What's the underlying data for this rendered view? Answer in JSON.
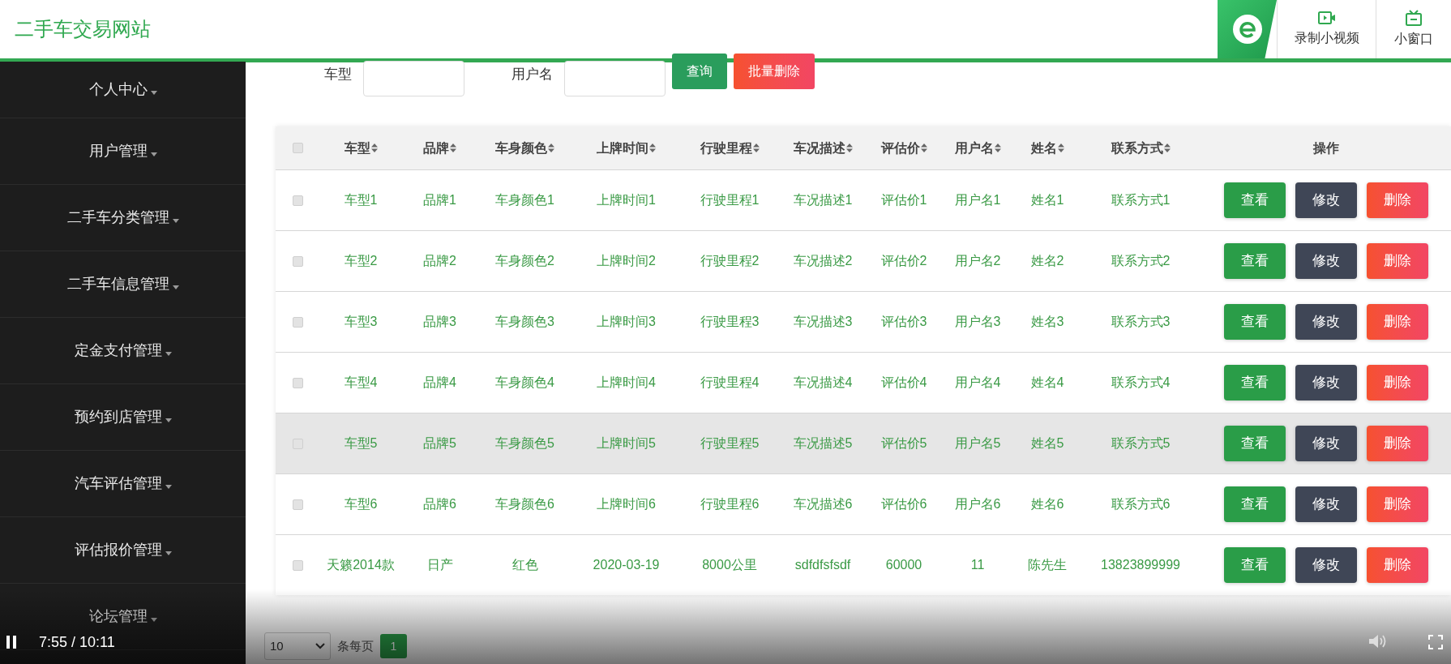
{
  "site_title": "二手车交易网站",
  "top_tools": [
    {
      "label": "录制小视频",
      "kind": "record"
    },
    {
      "label": "小窗口",
      "kind": "tv"
    }
  ],
  "sidebar": {
    "items": [
      {
        "label": "个人中心"
      },
      {
        "label": "用户管理"
      },
      {
        "label": "二手车分类管理"
      },
      {
        "label": "二手车信息管理"
      },
      {
        "label": "定金支付管理"
      },
      {
        "label": "预约到店管理"
      },
      {
        "label": "汽车评估管理"
      },
      {
        "label": "评估报价管理"
      },
      {
        "label": "论坛管理"
      }
    ]
  },
  "search": {
    "fields": [
      {
        "label": "车型"
      },
      {
        "label": "用户名"
      }
    ],
    "buttons": [
      {
        "label": "查询",
        "kind": "primary"
      },
      {
        "label": "批量删除",
        "kind": "danger"
      }
    ]
  },
  "table": {
    "select_all_checked": false,
    "columns": [
      {
        "label": "车型",
        "sortable": true
      },
      {
        "label": "品牌",
        "sortable": true
      },
      {
        "label": "车身颜色",
        "sortable": true
      },
      {
        "label": "上牌时间",
        "sortable": true
      },
      {
        "label": "行驶里程",
        "sortable": true
      },
      {
        "label": "车况描述",
        "sortable": true
      },
      {
        "label": "评估价",
        "sortable": true
      },
      {
        "label": "用户名",
        "sortable": true
      },
      {
        "label": "姓名",
        "sortable": true
      },
      {
        "label": "联系方式",
        "sortable": true
      },
      {
        "label": "操作",
        "sortable": false
      }
    ],
    "rows": [
      {
        "checked": false,
        "hovered": false,
        "cells": [
          "车型1",
          "品牌1",
          "车身颜色1",
          "上牌时间1",
          "行驶里程1",
          "车况描述1",
          "评估价1",
          "用户名1",
          "姓名1",
          "联系方式1"
        ],
        "actions": [
          {
            "label": "查看",
            "kind": "view"
          },
          {
            "label": "修改",
            "kind": "edit"
          },
          {
            "label": "删除",
            "kind": "delete"
          }
        ]
      },
      {
        "checked": false,
        "hovered": false,
        "cells": [
          "车型2",
          "品牌2",
          "车身颜色2",
          "上牌时间2",
          "行驶里程2",
          "车况描述2",
          "评估价2",
          "用户名2",
          "姓名2",
          "联系方式2"
        ],
        "actions": [
          {
            "label": "查看",
            "kind": "view"
          },
          {
            "label": "修改",
            "kind": "edit"
          },
          {
            "label": "删除",
            "kind": "delete"
          }
        ]
      },
      {
        "checked": false,
        "hovered": false,
        "cells": [
          "车型3",
          "品牌3",
          "车身颜色3",
          "上牌时间3",
          "行驶里程3",
          "车况描述3",
          "评估价3",
          "用户名3",
          "姓名3",
          "联系方式3"
        ],
        "actions": [
          {
            "label": "查看",
            "kind": "view"
          },
          {
            "label": "修改",
            "kind": "edit"
          },
          {
            "label": "删除",
            "kind": "delete"
          }
        ]
      },
      {
        "checked": false,
        "hovered": false,
        "cells": [
          "车型4",
          "品牌4",
          "车身颜色4",
          "上牌时间4",
          "行驶里程4",
          "车况描述4",
          "评估价4",
          "用户名4",
          "姓名4",
          "联系方式4"
        ],
        "actions": [
          {
            "label": "查看",
            "kind": "view"
          },
          {
            "label": "修改",
            "kind": "edit"
          },
          {
            "label": "删除",
            "kind": "delete"
          }
        ]
      },
      {
        "checked": false,
        "hovered": true,
        "cells": [
          "车型5",
          "品牌5",
          "车身颜色5",
          "上牌时间5",
          "行驶里程5",
          "车况描述5",
          "评估价5",
          "用户名5",
          "姓名5",
          "联系方式5"
        ],
        "actions": [
          {
            "label": "查看",
            "kind": "view"
          },
          {
            "label": "修改",
            "kind": "edit"
          },
          {
            "label": "删除",
            "kind": "delete"
          }
        ]
      },
      {
        "checked": false,
        "hovered": false,
        "cells": [
          "车型6",
          "品牌6",
          "车身颜色6",
          "上牌时间6",
          "行驶里程6",
          "车况描述6",
          "评估价6",
          "用户名6",
          "姓名6",
          "联系方式6"
        ],
        "actions": [
          {
            "label": "查看",
            "kind": "view"
          },
          {
            "label": "修改",
            "kind": "edit"
          },
          {
            "label": "删除",
            "kind": "delete"
          }
        ]
      },
      {
        "checked": false,
        "hovered": false,
        "cells": [
          "天籁2014款",
          "日产",
          "红色",
          "2020-03-19",
          "8000公里",
          "sdfdfsfsdf",
          "60000",
          "11",
          "陈先生",
          "13823899999"
        ],
        "actions": [
          {
            "label": "查看",
            "kind": "view"
          },
          {
            "label": "修改",
            "kind": "edit"
          },
          {
            "label": "删除",
            "kind": "delete"
          }
        ]
      }
    ]
  },
  "pagination": {
    "page_size": "10",
    "page_size_label": "条每页",
    "pages": [
      {
        "label": "1",
        "selected": true
      }
    ]
  },
  "video": {
    "time": "7:55 / 10:11",
    "playing": true
  }
}
